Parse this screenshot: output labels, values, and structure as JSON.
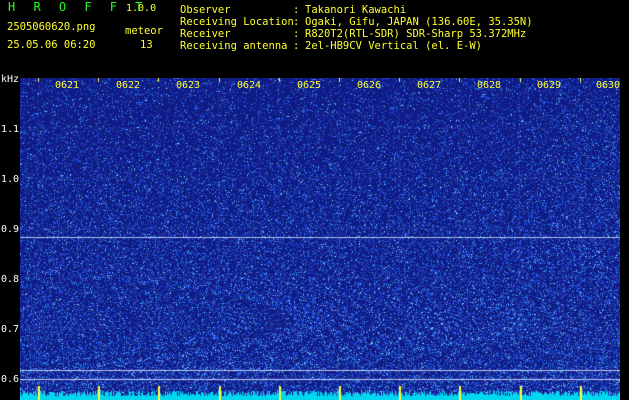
{
  "app": {
    "name": "H R O F F T",
    "version": "1.0.0"
  },
  "file": {
    "name": "2505060620.png",
    "datetime": "25.05.06 06:20"
  },
  "meteor": {
    "label": "meteor",
    "count": "13"
  },
  "info": [
    {
      "key": "Observer",
      "sep": ":",
      "value": "Takanori Kawachi"
    },
    {
      "key": "Receiving Location",
      "sep": ":",
      "value": "Ogaki, Gifu, JAPAN (136.60E, 35.35N)"
    },
    {
      "key": "Receiver",
      "sep": ":",
      "value": "R820T2(RTL-SDR) SDR-Sharp 53.372MHz"
    },
    {
      "key": "Receiving antenna",
      "sep": ":",
      "value": "2el-HB9CV Vertical (el. E-W)"
    }
  ],
  "axis": {
    "unit": "kHz",
    "time_labels": [
      "0621",
      "0622",
      "0623",
      "0624",
      "0625",
      "0626",
      "0627",
      "0628",
      "0629",
      "0630"
    ],
    "freq_labels": [
      "1.1",
      "1.0",
      "0.9",
      "0.8",
      "0.7",
      "0.6"
    ]
  },
  "colors": {
    "background": "#000000",
    "spectrum": "#1a2a9a",
    "trace": "#00e5ff",
    "tick": "#ffff30"
  }
}
